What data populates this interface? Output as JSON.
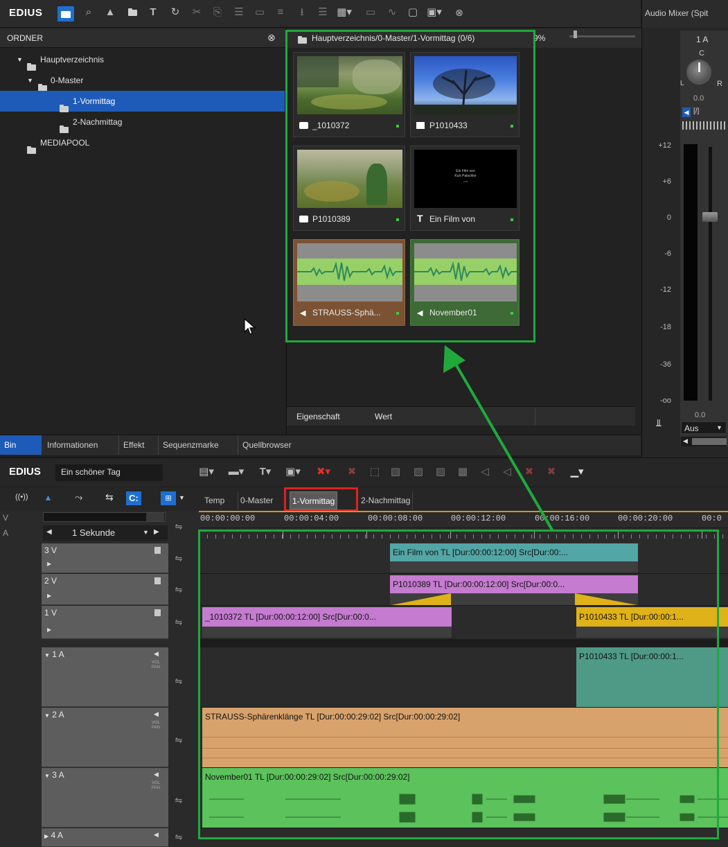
{
  "app": {
    "brand": "EDIUS"
  },
  "colors": {
    "highlight_green": "#1faa3c",
    "highlight_red": "#e02020",
    "selection_blue": "#1e5bb8",
    "video_clip": "#c57bd0",
    "title_clip": "#53a6a6",
    "audio_orange": "#d8a26c",
    "audio_green": "#5cc25c",
    "transition_yellow": "#e0b21a"
  },
  "bin_toolbar": {
    "icons": [
      "folder-icon",
      "search-icon",
      "up-icon",
      "open-folder-icon",
      "title-icon",
      "refresh-icon",
      "cut-icon",
      "copy-icon",
      "paste-icon",
      "add-to-timeline-icon",
      "insert-icon",
      "export-icon",
      "list-icon",
      "view-icon",
      "monitor-icon",
      "waveform-icon",
      "window-icon",
      "toolbox-icon",
      "close-icon"
    ]
  },
  "folder_panel": {
    "header": "ORDNER",
    "items": [
      {
        "label": "Hauptverzeichnis"
      },
      {
        "label": "0-Master"
      },
      {
        "label": "1-Vormittag"
      },
      {
        "label": "2-Nachmittag"
      },
      {
        "label": "MEDIAPOOL"
      }
    ]
  },
  "clip_panel": {
    "path": "Hauptverzeichnis/0-Master/1-Vormittag (0/6)",
    "zoom": "9%",
    "clips": [
      {
        "label": "_1010372",
        "type": "still"
      },
      {
        "label": "P1010433",
        "type": "video"
      },
      {
        "label": "P1010389",
        "type": "still"
      },
      {
        "label": "Ein Film von",
        "type": "title"
      },
      {
        "label": "STRAUSS-Sphä...",
        "type": "audio"
      },
      {
        "label": "November01",
        "type": "audio"
      }
    ],
    "title_thumb_text": {
      "line1": "Ein Film von",
      "line2": "Kurt Patschke",
      "line3": "1999"
    }
  },
  "property_panel": {
    "col1": "Eigenschaft",
    "col2": "Wert"
  },
  "bottom_tabs": [
    "Bin",
    "Informationen",
    "Effekt",
    "Sequenzmarke",
    "Quellbrowser"
  ],
  "mixer": {
    "title": "Audio Mixer (Spit",
    "channel": "1 A",
    "pan_left": "L",
    "pan_center": "C",
    "pan_right": "R",
    "pan_value": "0.0",
    "mute_label": "[/]",
    "scale": [
      "+12",
      "+6",
      "0",
      "-6",
      "-12",
      "-18",
      "-36",
      "-oo"
    ],
    "fader_value": "0.0",
    "mode": "Aus"
  },
  "timeline": {
    "project": "Ein schöner Tag",
    "tabs": [
      "Temp",
      "0-Master",
      "1-Vormittag",
      "2-Nachmittag"
    ],
    "active_tab": "1-Vormittag",
    "scale": "1 Sekunde",
    "v_label": "V",
    "a_label": "A",
    "timecodes": [
      "00:00:00:00",
      "00:00:04:00",
      "00:00:08:00",
      "00:00:12:00",
      "00:00:16:00",
      "00:00:20:00",
      "00:0"
    ],
    "tracks": [
      {
        "name": "3 V"
      },
      {
        "name": "2 V"
      },
      {
        "name": "1 V"
      },
      {
        "name": "1 A",
        "sub": "VOL PAN"
      },
      {
        "name": "2 A",
        "sub": "VOL PAN"
      },
      {
        "name": "3 A",
        "sub": "VOL PAN"
      },
      {
        "name": "4 A"
      }
    ],
    "clips": {
      "v3": "Ein Film von  TL [Dur:00:00:12:00]  Src[Dur:00:...",
      "v2": "P1010389  TL [Dur:00:00:12:00]  Src[Dur:00:0...",
      "v1a": "_1010372  TL [Dur:00:00:12:00]  Src[Dur:00:0...",
      "v1b": "P1010433  TL [Dur:00:00:1...",
      "a1": "P1010433  TL [Dur:00:00:1...",
      "a2": "STRAUSS-Sphärenklänge  TL [Dur:00:00:29:02]  Src[Dur:00:00:29:02]",
      "a3": "November01  TL [Dur:00:00:29:02]  Src[Dur:00:00:29:02]"
    }
  }
}
